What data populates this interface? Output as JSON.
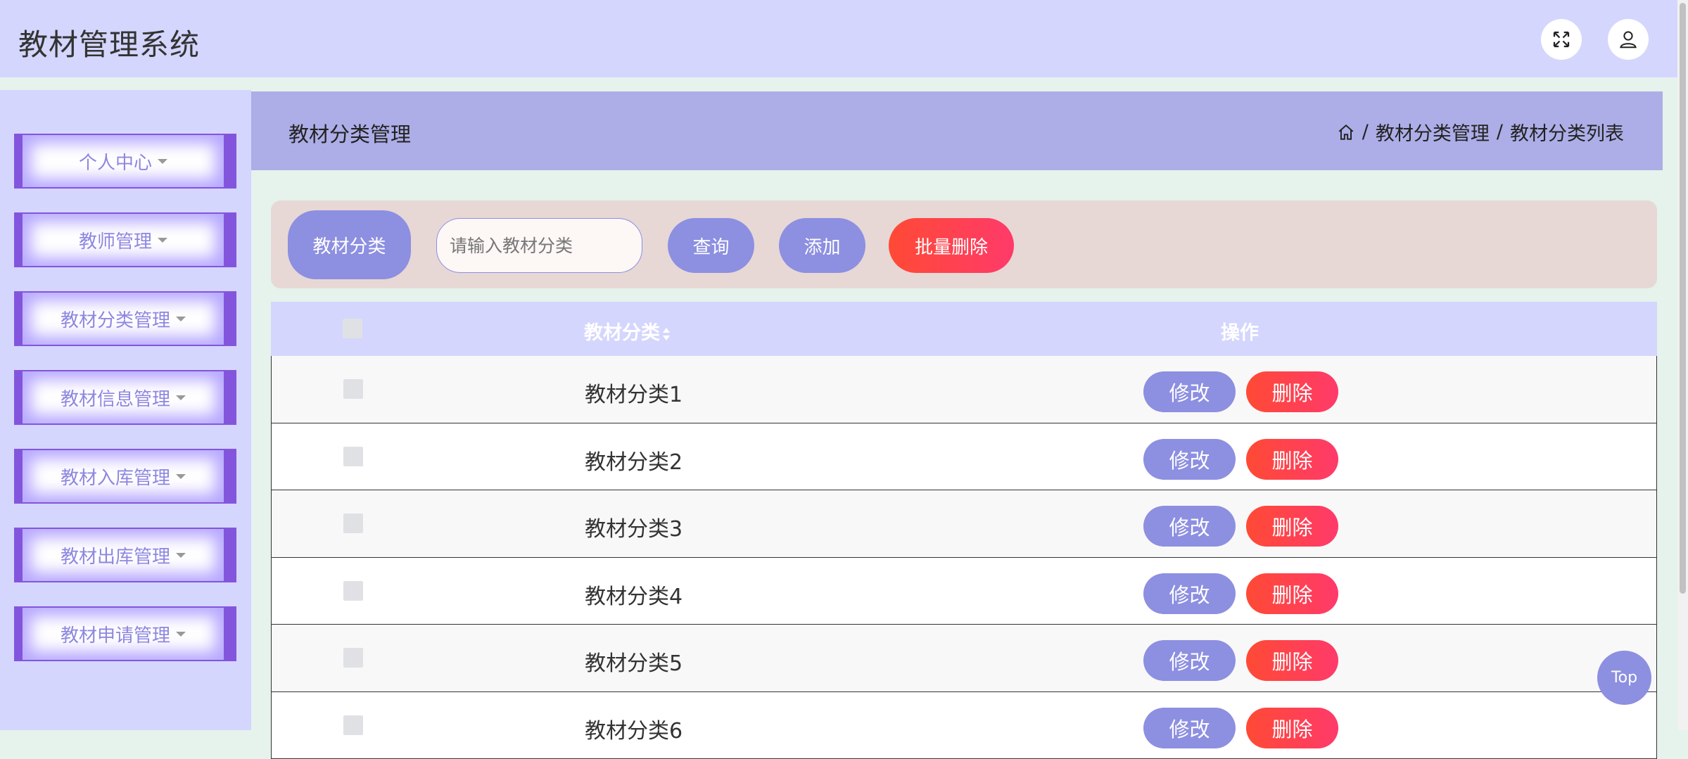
{
  "app": {
    "title": "教材管理系统"
  },
  "sidebar": {
    "items": [
      {
        "label": "个人中心"
      },
      {
        "label": "教师管理"
      },
      {
        "label": "教材分类管理"
      },
      {
        "label": "教材信息管理"
      },
      {
        "label": "教材入库管理"
      },
      {
        "label": "教材出库管理"
      },
      {
        "label": "教材申请管理"
      }
    ]
  },
  "page": {
    "title": "教材分类管理",
    "breadcrumb": [
      "教材分类管理",
      "教材分类列表"
    ],
    "separator": "/"
  },
  "search": {
    "field_label": "教材分类",
    "placeholder": "请输入教材分类",
    "value": "",
    "query_label": "查询",
    "add_label": "添加",
    "batch_delete_label": "批量删除"
  },
  "table": {
    "headers": {
      "category": "教材分类",
      "operations": "操作"
    },
    "edit_label": "修改",
    "delete_label": "删除",
    "rows": [
      {
        "category": "教材分类1"
      },
      {
        "category": "教材分类2"
      },
      {
        "category": "教材分类3"
      },
      {
        "category": "教材分类4"
      },
      {
        "category": "教材分类5"
      },
      {
        "category": "教材分类6"
      }
    ]
  },
  "top_button": {
    "label": "Top"
  },
  "colors": {
    "primary": "#8d8fe1",
    "danger": "#ff4a35",
    "header_bg": "#d4d6fd",
    "page_head_bg": "#adaee7",
    "search_bg": "#e7d8d6",
    "sidebar_accent": "#8355dc"
  },
  "icons": {
    "fullscreen": "fullscreen-icon",
    "user": "user-icon",
    "home": "home-icon",
    "menu_caret": "caret-down-icon",
    "sort": "sort-icon"
  }
}
